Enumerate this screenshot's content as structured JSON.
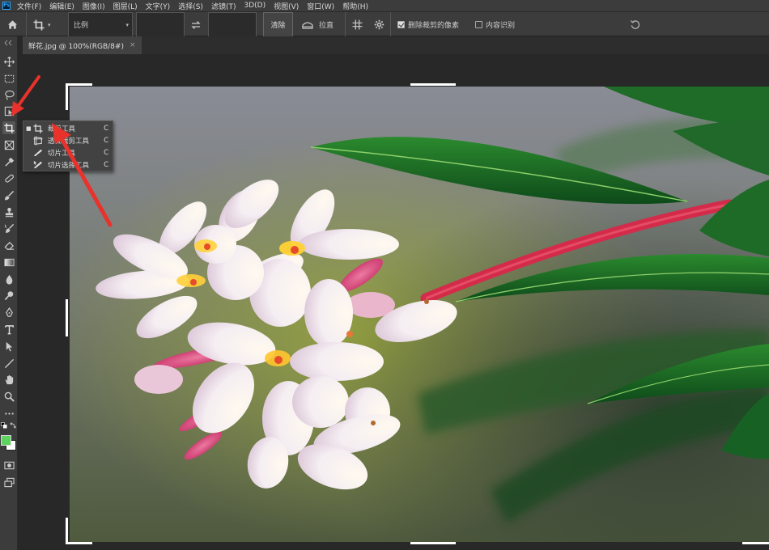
{
  "menubar": {
    "app_icon_text": "Ps",
    "items": [
      "文件(F)",
      "编辑(E)",
      "图像(I)",
      "图层(L)",
      "文字(Y)",
      "选择(S)",
      "滤镜(T)",
      "3D(D)",
      "视图(V)",
      "窗口(W)",
      "帮助(H)"
    ]
  },
  "options": {
    "ratio_label": "比例",
    "clear_label": "清除",
    "straighten_label": "拉直",
    "delete_cropped_label": "删除裁剪的像素",
    "delete_cropped_checked": true,
    "content_aware_label": "内容识别",
    "content_aware_checked": false
  },
  "document_tab": {
    "title": "鲜花.jpg @ 100%(RGB/8#)",
    "close": "×"
  },
  "flyout": {
    "items": [
      {
        "label": "裁剪工具",
        "shortcut": "C",
        "selected": true,
        "icon": "crop-icon"
      },
      {
        "label": "透视裁剪工具",
        "shortcut": "C",
        "selected": false,
        "icon": "perspective-crop-icon"
      },
      {
        "label": "切片工具",
        "shortcut": "C",
        "selected": false,
        "icon": "slice-icon"
      },
      {
        "label": "切片选择工具",
        "shortcut": "C",
        "selected": false,
        "icon": "slice-select-icon"
      }
    ]
  },
  "colors": {
    "foreground": "#5fd35f",
    "background": "#ffffff",
    "annotation_arrow": "#e8322b"
  },
  "photo": {
    "subject": "frangipani-flowers"
  }
}
